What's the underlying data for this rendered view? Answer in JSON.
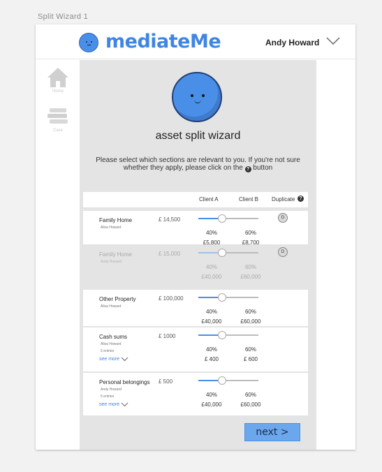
{
  "frame_label": "Split Wizard 1",
  "header": {
    "logo_text": "mediateMe",
    "user_name": "Andy Howard"
  },
  "sidebar": {
    "items": [
      {
        "label": "Home",
        "icon": "home-icon"
      },
      {
        "label": "Case",
        "icon": "stack-icon"
      }
    ]
  },
  "wizard": {
    "title": "asset split wizard",
    "instructions_before": "Please select which sections are relevant to you. If you're not sure whether they apply, please click on the",
    "help_glyph": "?",
    "instructions_after": "button"
  },
  "table": {
    "headers": {
      "client_a": "Client A",
      "client_b": "Client B",
      "duplicate": "Duplicate",
      "help_glyph": "?"
    },
    "rows": [
      {
        "name": "Family Home",
        "who": "Alisa Howard",
        "amount": "£ 14,500",
        "split_a": 0.4,
        "pct_a": "40%",
        "pct_b": "60%",
        "val_a": "£5,800",
        "val_b": "£8,700",
        "duplicate": "D",
        "dim": false
      },
      {
        "name": "Family Home",
        "who": "Andy Howard",
        "amount": "£ 15,000",
        "split_a": 0.4,
        "pct_a": "40%",
        "pct_b": "60%",
        "val_a": "£40,000",
        "val_b": "£60,000",
        "duplicate": "D",
        "dim": true
      },
      {
        "name": "Other Property",
        "who": "Alisa Howard",
        "amount": "£ 100,000",
        "split_a": 0.4,
        "pct_a": "40%",
        "pct_b": "60%",
        "val_a": "£40,000",
        "val_b": "£60,000",
        "dim": false
      },
      {
        "name": "Cash sums",
        "who": "Alisa Howard",
        "entries": "5 entries",
        "see_more": "see more",
        "amount": "£ 1000",
        "split_a": 0.4,
        "pct_a": "40%",
        "pct_b": "60%",
        "val_a": "£ 400",
        "val_b": "£ 600",
        "dim": false
      },
      {
        "name": "Personal belongings",
        "who": "Andy Howard",
        "entries": "5 entries",
        "see_more": "see more",
        "amount": "£ 500",
        "split_a": 0.4,
        "pct_a": "40%",
        "pct_b": "60%",
        "val_a": "£40,000",
        "val_b": "£60,000",
        "dim": false
      }
    ]
  },
  "next_label": "next >",
  "colors": {
    "accent": "#3f86e3",
    "button": "#6aa7ec",
    "panel": "#e4e4e4"
  }
}
